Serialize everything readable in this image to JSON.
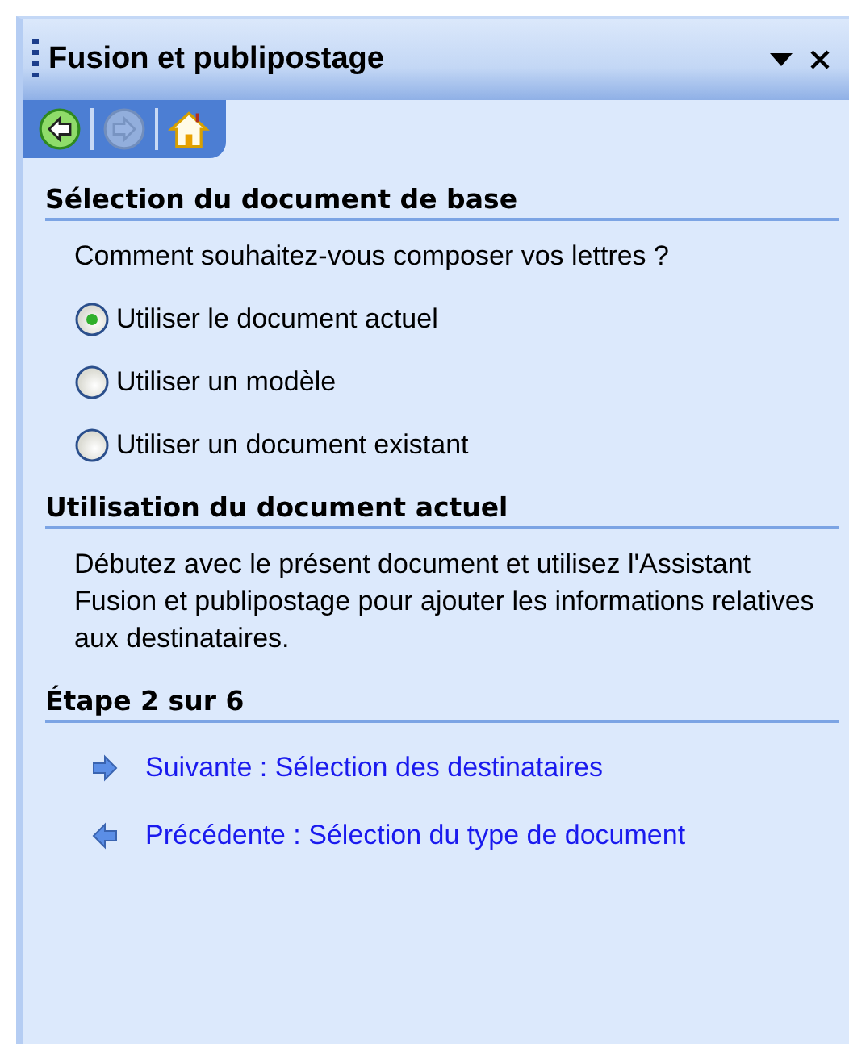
{
  "pane": {
    "title": "Fusion et publipostage"
  },
  "nav": [
    {
      "kind": "back",
      "disabled": false
    },
    {
      "kind": "forward",
      "disabled": true
    },
    {
      "kind": "home",
      "disabled": false
    }
  ],
  "sections": [
    {
      "heading": "Sélection du document de base",
      "text": "Comment souhaitez-vous composer vos lettres ?",
      "options": [
        {
          "label": "Utiliser le document actuel",
          "selected": true
        },
        {
          "label": "Utiliser un modèle",
          "selected": false
        },
        {
          "label": "Utiliser un document existant",
          "selected": false
        }
      ]
    },
    {
      "heading": "Utilisation du document actuel",
      "text": "Débutez avec le présent document et utilisez l'Assistant Fusion et publipostage pour ajouter les informations relatives aux destinataires."
    },
    {
      "heading": "Étape 2 sur 6",
      "links": [
        {
          "kind": "next",
          "label": "Suivante : Sélection des destinataires"
        },
        {
          "kind": "previous",
          "label": "Précédente : Sélection du type de document"
        }
      ]
    }
  ]
}
